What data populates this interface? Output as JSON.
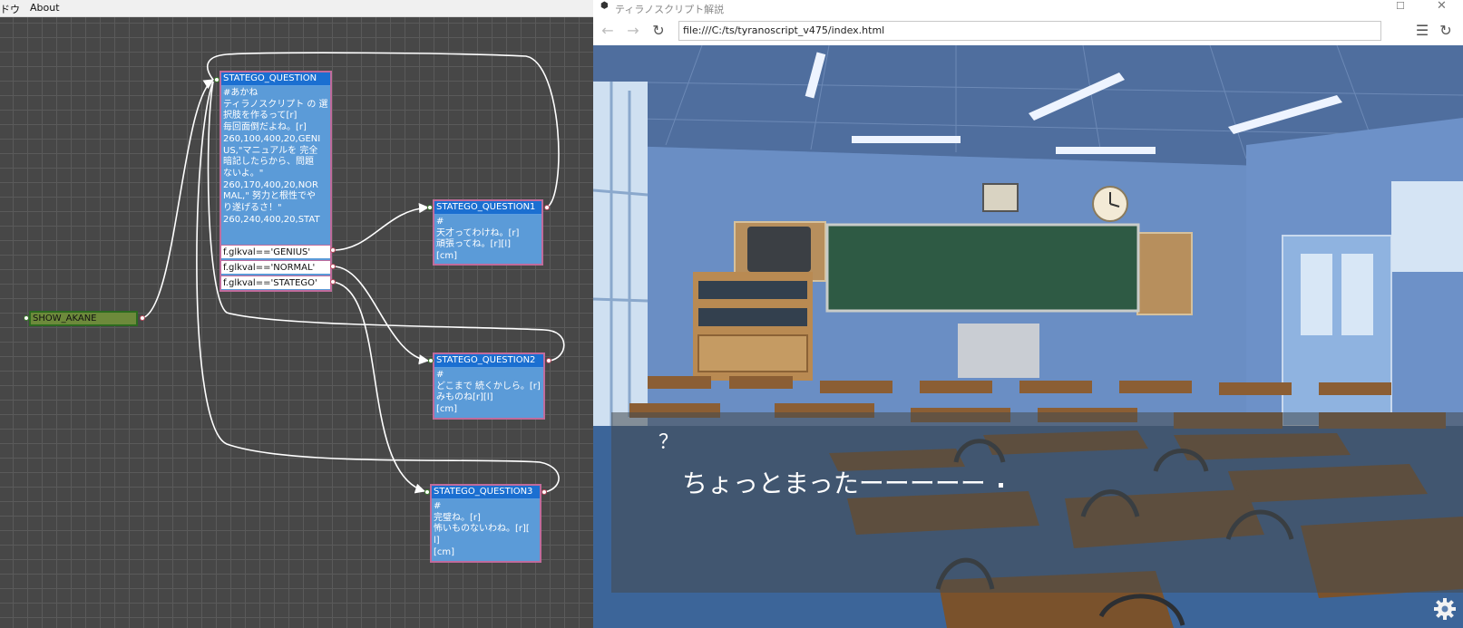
{
  "editor": {
    "menu": {
      "item1": "ドウ",
      "item2": "About"
    },
    "nodes": {
      "show": {
        "title": "SHOW_AKANE"
      },
      "question": {
        "title": "STATEGO_QUESTION",
        "lines": [
          "#あかね",
          "ティラノスクリプト の 選",
          "択肢を作るって[r]",
          "毎回面倒だよね。[r]",
          "260,100,400,20,GENI",
          "US,\"マニュアルを 完全",
          "暗記したらから、問題",
          "ないよ。\"",
          "260,170,400,20,NOR",
          "MAL,\" 努力と根性でや",
          "り遂げるさ！\"",
          "260,240,400,20,STAT"
        ],
        "conditions": [
          "f.glkval=='GENIUS'",
          "f.glkval=='NORMAL'",
          "f.glkval=='STATEGO'"
        ]
      },
      "q1": {
        "title": "STATEGO_QUESTION1",
        "lines": [
          "#",
          "天才ってわけね。[r]",
          "頑張ってね。[r][l]",
          "[cm]"
        ]
      },
      "q2": {
        "title": "STATEGO_QUESTION2",
        "lines": [
          "#",
          "どこまで 続くかしら。[r]",
          "みものね[r][l]",
          "[cm]"
        ]
      },
      "q3": {
        "title": "STATEGO_QUESTION3",
        "lines": [
          "#",
          "完璧ね。[r]",
          "怖いものないわね。[r][",
          "l]",
          "[cm]"
        ]
      }
    }
  },
  "browser": {
    "window_title": "ティラノスクリプト解説",
    "address": "file:///C:/ts/tyranoscript_v475/index.html",
    "nav": {
      "back": "←",
      "forward": "→",
      "reload": "↻",
      "menu": "☰",
      "reload2": "↻"
    },
    "game": {
      "speaker": "？",
      "message": "ちょっとまったーーーーー"
    }
  },
  "colors": {
    "node_title": "#1b6fd1",
    "node_body": "#5b9bd8",
    "node_border": "#c06b9b",
    "show_node": "#6d8a3b",
    "canvas": "#474747"
  }
}
